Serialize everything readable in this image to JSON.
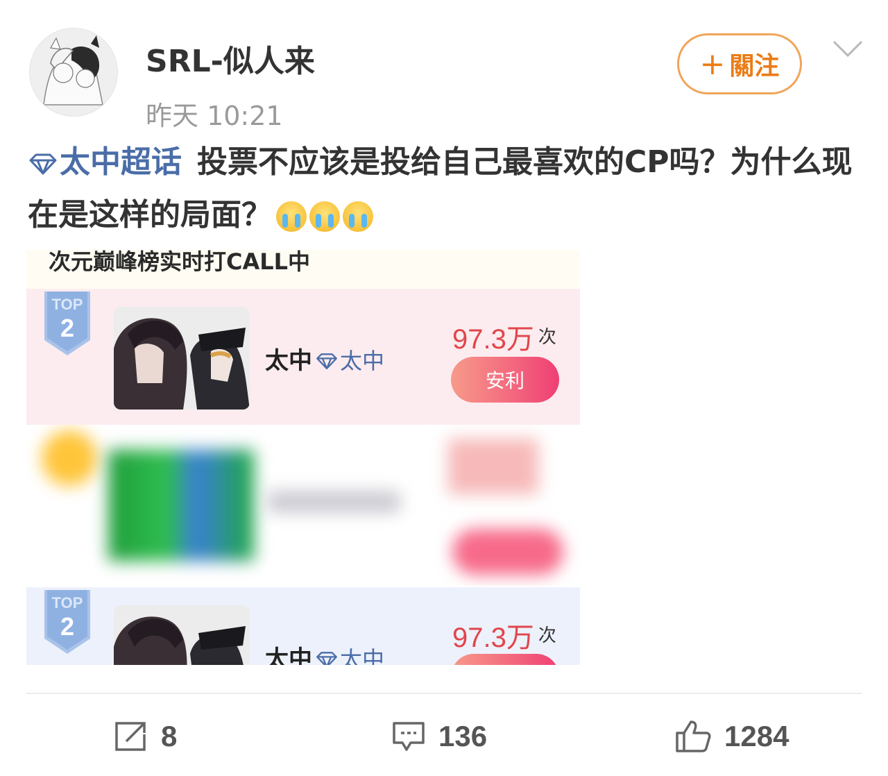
{
  "header": {
    "username": "SRL-似人来",
    "timestamp": "昨天 10:21",
    "follow_label": "關注",
    "follow_plus": "+"
  },
  "post": {
    "topic": "太中超话",
    "text": "投票不应该是投给自己最喜欢的CP吗？为什么现在是这样的局面？",
    "emojis": [
      "crying-face",
      "crying-face",
      "crying-face"
    ]
  },
  "image": {
    "header_text": "次元巅峰榜实时打CALL中",
    "cards": [
      {
        "badge_top": "TOP",
        "badge_num": "2",
        "cp_name": "太中",
        "cp_tag": "太中",
        "count": "97.3万",
        "count_unit": "次",
        "button": "安利"
      },
      {
        "badge_top": "TOP",
        "badge_num": "2",
        "cp_name": "太中",
        "cp_tag": "太中",
        "count": "97.3万",
        "count_unit": "次"
      }
    ]
  },
  "actions": {
    "share_count": "8",
    "comment_count": "136",
    "like_count": "1284"
  },
  "colors": {
    "accent_orange": "#eb7c16",
    "topic_blue": "#4a6da7",
    "count_red": "#e0464c",
    "card_pink": "#fcecef",
    "card_blue": "#edf1fb"
  }
}
